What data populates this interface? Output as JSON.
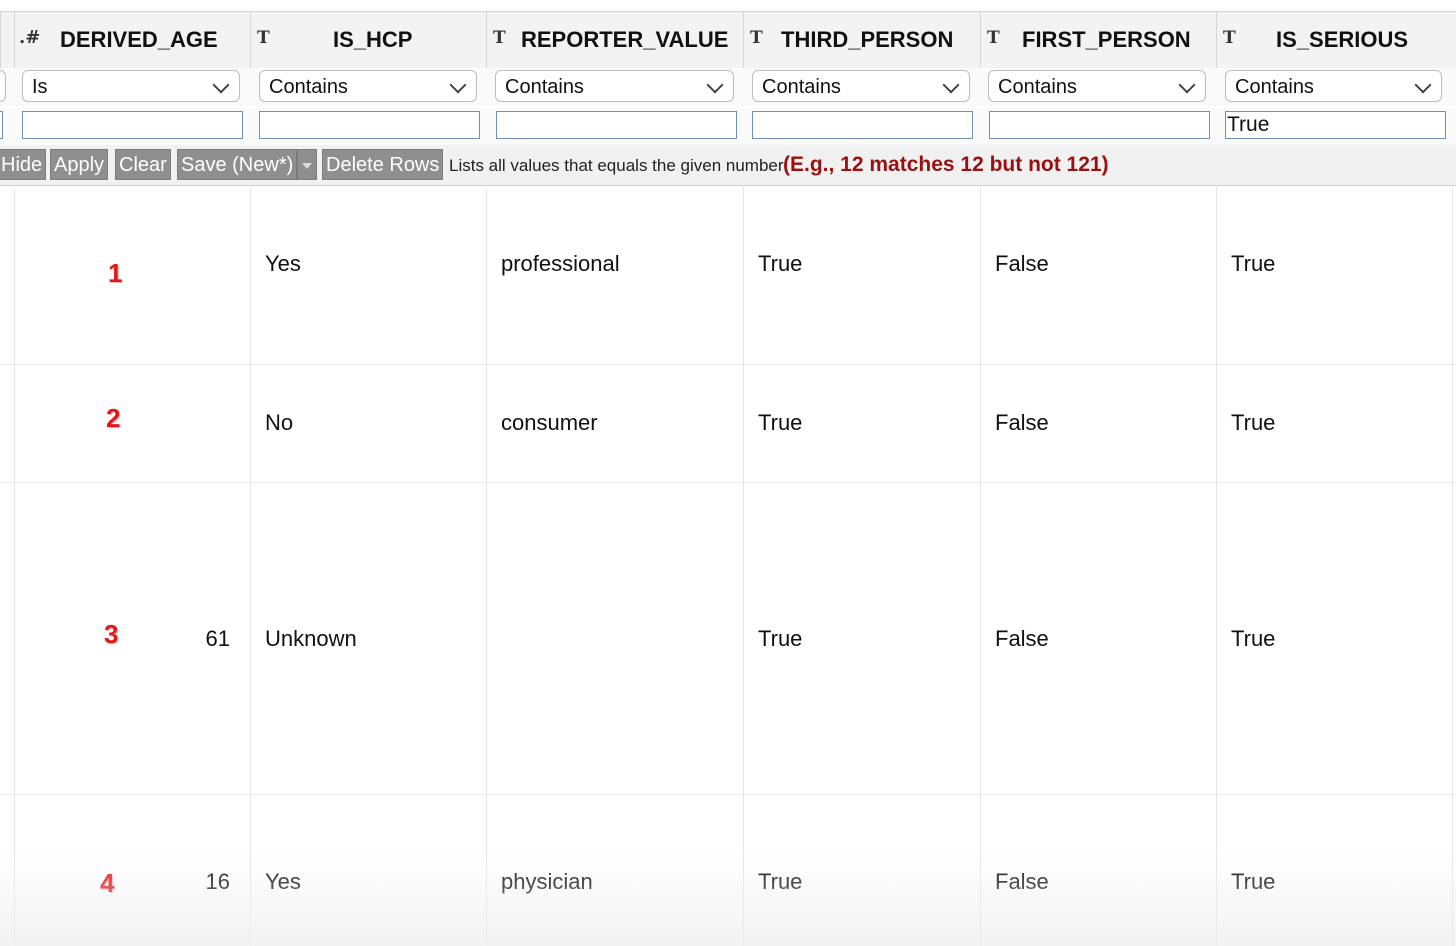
{
  "columns": [
    {
      "type_icon": ".#",
      "name": "DERIVED_AGE"
    },
    {
      "type_icon": "T",
      "name": "IS_HCP"
    },
    {
      "type_icon": "T",
      "name": "REPORTER_VALUE"
    },
    {
      "type_icon": "T",
      "name": "THIRD_PERSON"
    },
    {
      "type_icon": "T",
      "name": "FIRST_PERSON"
    },
    {
      "type_icon": "T",
      "name": "IS_SERIOUS"
    }
  ],
  "filters": {
    "operators": [
      "Is",
      "Contains",
      "Contains",
      "Contains",
      "Contains",
      "Contains"
    ],
    "values": [
      "",
      "",
      "",
      "",
      "",
      "True"
    ]
  },
  "toolbar": {
    "hide": "Hide",
    "apply": "Apply",
    "clear": "Clear",
    "save": "Save (New*)",
    "delete_rows": "Delete Rows",
    "hint": "Lists all values that equals the given number",
    "hint_example": "(E.g., 12 matches 12 but not 121)"
  },
  "rows": [
    {
      "num": "1",
      "derived_age": "",
      "is_hcp": "Yes",
      "reporter_value": "professional",
      "third_person": "True",
      "first_person": "False",
      "is_serious": "True"
    },
    {
      "num": "2",
      "derived_age": "",
      "is_hcp": "No",
      "reporter_value": "consumer",
      "third_person": "True",
      "first_person": "False",
      "is_serious": "True"
    },
    {
      "num": "3",
      "derived_age": "61",
      "is_hcp": "Unknown",
      "reporter_value": "",
      "third_person": "True",
      "first_person": "False",
      "is_serious": "True"
    },
    {
      "num": "4",
      "derived_age": "16",
      "is_hcp": "Yes",
      "reporter_value": "physician",
      "third_person": "True",
      "first_person": "False",
      "is_serious": "True"
    }
  ]
}
